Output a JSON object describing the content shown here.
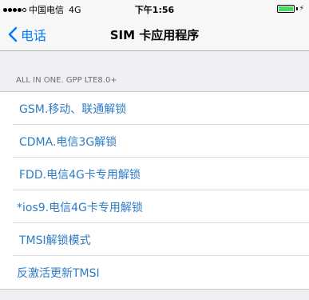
{
  "status_bar": {
    "carrier": "中国电信",
    "network": "4G",
    "time": "下午1:56",
    "battery_color": "#4cd964"
  },
  "nav": {
    "back_label": "电话",
    "title": "SIM 卡应用程序",
    "accent": "#007aff"
  },
  "section": {
    "header": "ALL IN ONE. GPP LTE8.0+"
  },
  "items": [
    {
      "label": "GSM.移动、联通解锁"
    },
    {
      "label": "CDMA.电信3G解锁"
    },
    {
      "label": "FDD.电信4G卡专用解锁"
    },
    {
      "label": "*ios9.电信4G卡专用解锁"
    },
    {
      "label": "TMSI解锁模式"
    },
    {
      "label": "反激活更新TMSI"
    }
  ]
}
